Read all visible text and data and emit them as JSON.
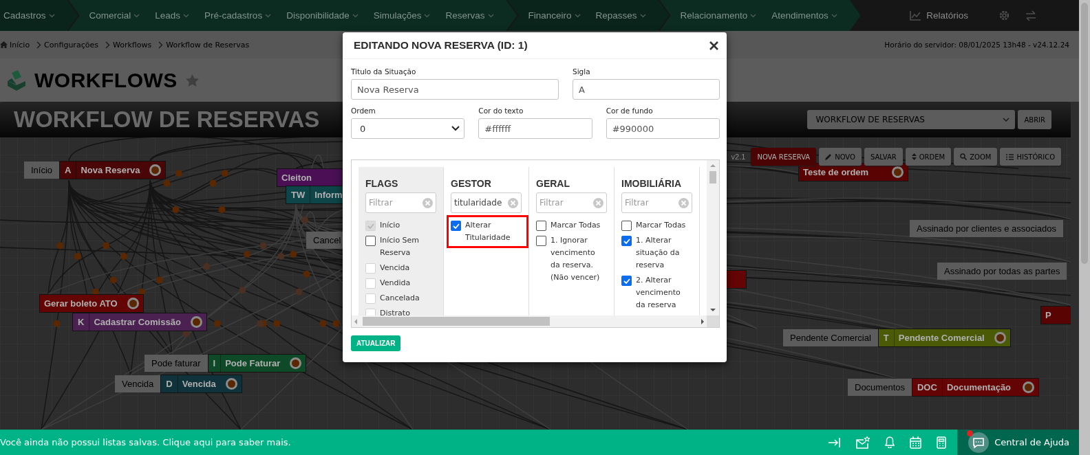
{
  "nav": {
    "groups": [
      {
        "items": [
          "Cadastros"
        ]
      },
      {
        "items": [
          "Comercial",
          "Leads",
          "Pré-cadastros",
          "Disponibilidade",
          "Simulações",
          "Reservas"
        ]
      },
      {
        "items": [
          "Financeiro",
          "Repasses"
        ]
      },
      {
        "items": [
          "Relacionamento",
          "Atendimentos"
        ]
      }
    ],
    "reports": "Relatórios"
  },
  "breadcrumb": {
    "items": [
      "Início",
      "Configurações",
      "Workflows",
      "Workflow de Reservas"
    ],
    "server_time": "Horário do servidor: 08/01/2025 13h48 - v24.12.24"
  },
  "page_title": "WORKFLOWS",
  "banner": {
    "title": "WORKFLOW DE RESERVAS",
    "workflow_select": "WORKFLOW DE RESERVAS",
    "open_button": "ABRIR"
  },
  "canvas": {
    "version": "v2.1",
    "toolbar": [
      {
        "label": "NOVA RESERVA",
        "kind": "status"
      },
      {
        "label": "NOVO",
        "kind": "edit"
      },
      {
        "label": "SALVAR",
        "kind": "save"
      },
      {
        "label": "ORDEM",
        "kind": "order"
      },
      {
        "label": "ZOOM",
        "kind": "zoom"
      },
      {
        "label": "HISTÓRICO",
        "kind": "history"
      }
    ],
    "nodes": [
      {
        "label": "Início",
        "code": "A",
        "name": "Nova Reserva",
        "color": "#4a0606"
      },
      {
        "name": "Cleiton",
        "color": "#4a0f55"
      },
      {
        "code": "TW",
        "name": "Inform",
        "color": "#0d4548"
      },
      {
        "label": "Cancel"
      },
      {
        "name": "Gerar boleto ATO",
        "color": "#650404"
      },
      {
        "code": "K",
        "name": "Cadastrar Comissão",
        "color": "#4a2150"
      },
      {
        "label": "Pode faturar",
        "code": "I",
        "name": "Pode Faturar",
        "color": "#0f4a28"
      },
      {
        "label": "Vencida",
        "code": "D",
        "name": "Vencida",
        "color": "#10323a"
      },
      {
        "name": "Teste de ordem",
        "color": "#5a0303"
      },
      {
        "label": "Assinado por clientes e associados"
      },
      {
        "label": "Assinado por todas as partes"
      },
      {
        "name": "P",
        "color": "#5a0303"
      },
      {
        "label": "Pendente Comercial",
        "code": "T",
        "name": "Pendente Comercial",
        "color": "#4a5a06"
      },
      {
        "label": "Documentos",
        "code": "DOC",
        "name": "Documentação",
        "color": "#650404"
      },
      {
        "color": "#650404"
      }
    ]
  },
  "modal": {
    "title": "EDITANDO NOVA RESERVA (ID: 1)",
    "fields": [
      {
        "label": "Titulo da Situação",
        "value": "Nova Reserva",
        "kind": "text"
      },
      {
        "label": "Sigla",
        "value": "A",
        "kind": "text"
      },
      {
        "label": "Ordem",
        "value": "0",
        "kind": "select"
      },
      {
        "label": "Cor do texto",
        "value": "#ffffff",
        "kind": "text"
      },
      {
        "label": "Cor de fundo",
        "value": "#990000",
        "kind": "text"
      }
    ],
    "columns": [
      {
        "title": "FLAGS",
        "filter": {
          "placeholder": "Filtrar"
        },
        "items": [
          {
            "label": "Início",
            "checked": true,
            "disabled": true,
            "highlighted": false
          },
          {
            "label": "Início Sem Reserva",
            "checked": false,
            "disabled": false,
            "highlighted": false
          },
          {
            "label": "Vencida",
            "checked": false,
            "disabled": true,
            "highlighted": false
          },
          {
            "label": "Vendida",
            "checked": false,
            "disabled": true,
            "highlighted": false
          },
          {
            "label": "Cancelada",
            "checked": false,
            "disabled": true,
            "highlighted": false
          },
          {
            "label": "Distrato",
            "checked": false,
            "disabled": true,
            "highlighted": false
          }
        ]
      },
      {
        "title": "GESTOR",
        "filter": {
          "value": "titularidade"
        },
        "items": [
          {
            "label": "Alterar Titularidade",
            "checked": true,
            "disabled": false,
            "highlighted": true
          }
        ]
      },
      {
        "title": "GERAL",
        "filter": {
          "placeholder": "Filtrar"
        },
        "items": [
          {
            "label": "Marcar Todas",
            "checked": false,
            "disabled": false,
            "highlighted": false
          },
          {
            "label": "1. Ignorar vencimento da reserva. (Não vencer)",
            "checked": false,
            "disabled": false,
            "highlighted": false
          }
        ]
      },
      {
        "title": "IMOBILIÁRIA",
        "filter": {
          "placeholder": "Filtrar"
        },
        "items": [
          {
            "label": "Marcar Todas",
            "checked": false,
            "disabled": false,
            "highlighted": false
          },
          {
            "label": "1. Alterar situação da reserva",
            "checked": true,
            "disabled": false,
            "highlighted": false
          },
          {
            "label": "2. Alterar vencimento da reserva",
            "checked": true,
            "disabled": false,
            "highlighted": false
          }
        ]
      }
    ],
    "submit": "ATUALIZAR"
  },
  "footer": {
    "message": "Você ainda não possui listas salvas. Clique aqui para saber mais.",
    "help": "Central de Ajuda",
    "notification": true
  }
}
